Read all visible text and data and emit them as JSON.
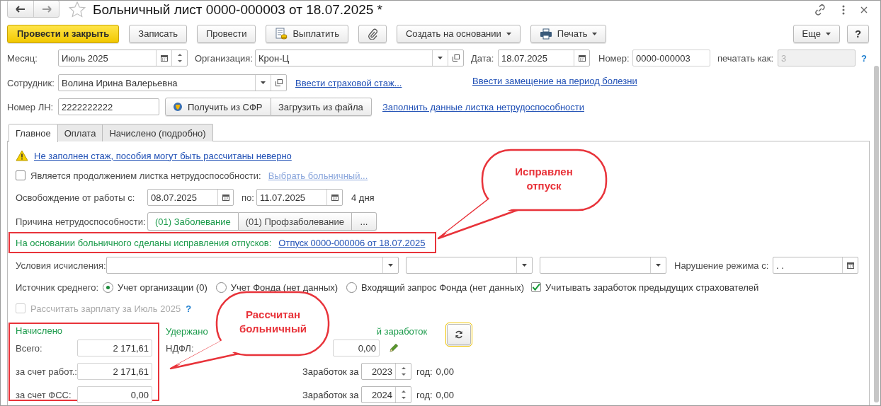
{
  "window": {
    "title": "Больничный лист 0000-000003 от 18.07.2025 *"
  },
  "toolbar": [
    {
      "kind": "primary",
      "label": "Провести и закрыть"
    },
    {
      "kind": "plain",
      "label": "Записать"
    },
    {
      "kind": "plain",
      "label": "Провести"
    },
    {
      "kind": "pay",
      "label": "Выплатить"
    },
    {
      "kind": "attach"
    },
    {
      "kind": "menu",
      "label": "Создать на основании"
    },
    {
      "kind": "print",
      "label": "Печать"
    }
  ],
  "toolbar_right": [
    {
      "kind": "menu",
      "label": "Еще"
    },
    {
      "kind": "help",
      "label": "?"
    }
  ],
  "month": {
    "label": "Месяц:",
    "value": "Июль 2025"
  },
  "organization": {
    "label": "Организация:",
    "value": "Крон-Ц"
  },
  "date": {
    "label": "Дата:",
    "value": "18.07.2025"
  },
  "number": {
    "label": "Номер:",
    "value": "0000-000003"
  },
  "print_as": {
    "label": "печатать как:",
    "value": "3",
    "disabled": true,
    "help": "?"
  },
  "employee": {
    "label": "Сотрудник:",
    "value": "Волина Ирина Валерьевна",
    "link": "Ввести страховой стаж...",
    "link_2": "Ввести замещение на период болезни"
  },
  "ln_number": {
    "label": "Номер ЛН:",
    "value": "2222222222",
    "buttons": [
      "Получить из СФР",
      "Загрузить из файла"
    ],
    "link": "Заполнить данные листка нетрудоспособности"
  },
  "tabs": [
    {
      "label": "Главное",
      "selected": true
    },
    {
      "label": "Оплата",
      "selected": false
    },
    {
      "label": "Начислено (подробно)",
      "selected": false
    }
  ],
  "warning": {
    "link": "Не заполнен стаж, пособия могут быть рассчитаны неверно"
  },
  "continuation": {
    "label": "Является продолжением листка нетрудоспособности:",
    "checked": false,
    "link": "Выбрать больничный...",
    "link_disabled": true
  },
  "release": {
    "label": "Освобождение от работы с:",
    "from": "08.07.2025",
    "to_label": "по:",
    "to": "11.07.2025",
    "days": "4 дня"
  },
  "reason": {
    "label": "Причина нетрудоспособности:",
    "options": [
      {
        "label": "(01) Заболевание",
        "selected": true
      },
      {
        "label": "(01) Профзаболевание",
        "selected": false
      }
    ],
    "more": "..."
  },
  "corrections": {
    "text": "На основании больничного сделаны исправления отпусков:",
    "link": "Отпуск 0000-000006 от 18.07.2025"
  },
  "conditions": {
    "label": "Условия исчисления:",
    "violation_label": "Нарушение режима с:",
    "violation_value": ". ."
  },
  "avg_source": {
    "label": "Источник среднего:",
    "options": [
      {
        "label": "Учет организации (0)",
        "selected": true
      },
      {
        "label": "Учет Фонда (нет данных)",
        "selected": false
      },
      {
        "label": "Входящий запрос Фонда (нет данных)",
        "selected": false
      }
    ],
    "prev_insurers": {
      "label": "Учитывать заработок предыдущих страхователей",
      "checked": true
    }
  },
  "calc_salary": {
    "label": "Рассчитать зарплату за Июль 2025",
    "checked": false,
    "disabled": true,
    "help": "?"
  },
  "accrued": {
    "title": "Начислено",
    "rows": [
      {
        "label": "Всего:",
        "value": "2 171,61"
      },
      {
        "label": "за счет работ.:",
        "value": "2 171,61"
      },
      {
        "label": "за счет ФСС:",
        "value": "0,00"
      }
    ]
  },
  "withheld": {
    "title": "Удержано",
    "ndfl_label": "НДФЛ:",
    "ndfl_value": "0,00"
  },
  "avg_earnings": {
    "title": "й заработок",
    "years": [
      {
        "label": "Заработок за",
        "year": "2023",
        "suffix": "год:",
        "amount": "0,00"
      },
      {
        "label": "Заработок за",
        "year": "2024",
        "suffix": "год:",
        "amount": "0,00"
      }
    ]
  },
  "callouts": [
    {
      "text": "Исправлен отпуск"
    },
    {
      "text": "Рассчитан больничный"
    }
  ]
}
